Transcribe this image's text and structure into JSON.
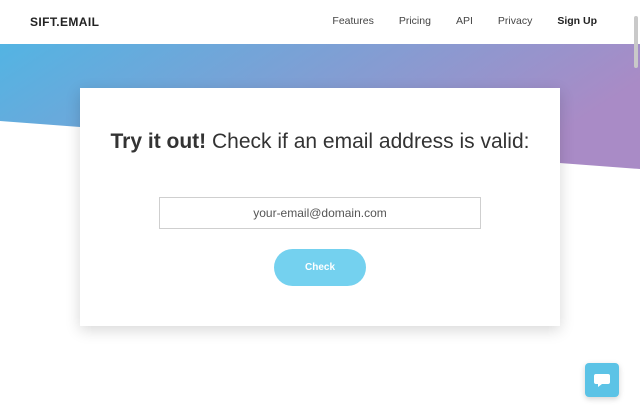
{
  "header": {
    "logo": "SIFT.EMAIL",
    "nav": [
      {
        "label": "Features"
      },
      {
        "label": "Pricing"
      },
      {
        "label": "API"
      },
      {
        "label": "Privacy"
      },
      {
        "label": "Sign Up"
      }
    ]
  },
  "hero": {
    "gradient_start": "#53b4e3",
    "gradient_end": "#a98bc6"
  },
  "card": {
    "headline_bold": "Try it out!",
    "headline_rest": " Check if an email address is valid:",
    "input_placeholder": "your-email@domain.com",
    "input_value": "",
    "button_label": "Check",
    "button_color": "#74d1ef"
  },
  "chat_widget": {
    "icon": "chat-bubble-icon",
    "color": "#5cc3e6"
  }
}
